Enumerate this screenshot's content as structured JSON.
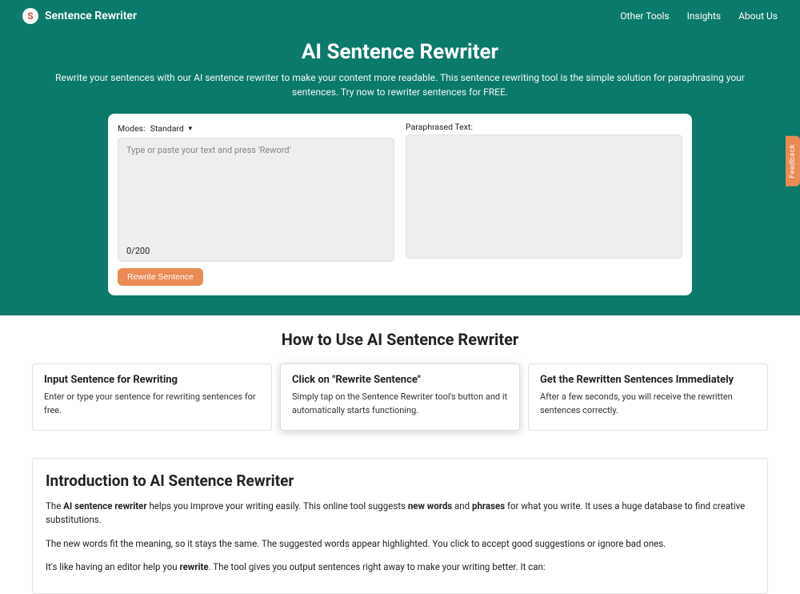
{
  "brand": {
    "logo_letter": "S",
    "name": "Sentence Rewriter"
  },
  "nav": {
    "other_tools": "Other Tools",
    "insights": "Insights",
    "about": "About Us"
  },
  "hero": {
    "title": "AI Sentence Rewriter",
    "subtitle": "Rewrite your sentences with our AI sentence rewriter to make your content more readable. This sentence rewriting tool is the simple solution for paraphrasing your sentences. Try now to rewriter sentences for FREE."
  },
  "tool": {
    "modes_label": "Modes:",
    "mode_selected": "Standard",
    "input_placeholder": "Type or paste your text and press 'Reword'",
    "word_count": "0/200",
    "button_label": "Rewrite Sentence",
    "output_label": "Paraphrased Text:"
  },
  "howto": {
    "title": "How to Use AI Sentence Rewriter",
    "cards": [
      {
        "heading": "Input Sentence for Rewriting",
        "body": "Enter or type your sentence for rewriting sentences for free."
      },
      {
        "heading": "Click on \"Rewrite Sentence\"",
        "body": "Simply tap on the Sentence Rewriter tool's button and it automatically starts functioning."
      },
      {
        "heading": "Get the Rewritten Sentences Immediately",
        "body": "After a few seconds, you will receive the rewritten sentences correctly."
      }
    ]
  },
  "intro": {
    "heading": "Introduction to AI Sentence Rewriter",
    "p1_a": "The ",
    "p1_b": "AI sentence rewriter",
    "p1_c": " helps you improve your writing easily. This online tool suggests ",
    "p1_d": "new words",
    "p1_e": " and ",
    "p1_f": "phrases",
    "p1_g": " for what you write. It uses a huge database to find creative substitutions.",
    "p2": "The new words fit the meaning, so it stays the same. The suggested words appear highlighted. You click to accept good suggestions or ignore bad ones.",
    "p3_a": "It's like having an editor help you ",
    "p3_b": "rewrite",
    "p3_c": ". The tool gives you output sentences right away to make your writing better. It can:"
  },
  "feedback": {
    "label": "Feedback"
  }
}
